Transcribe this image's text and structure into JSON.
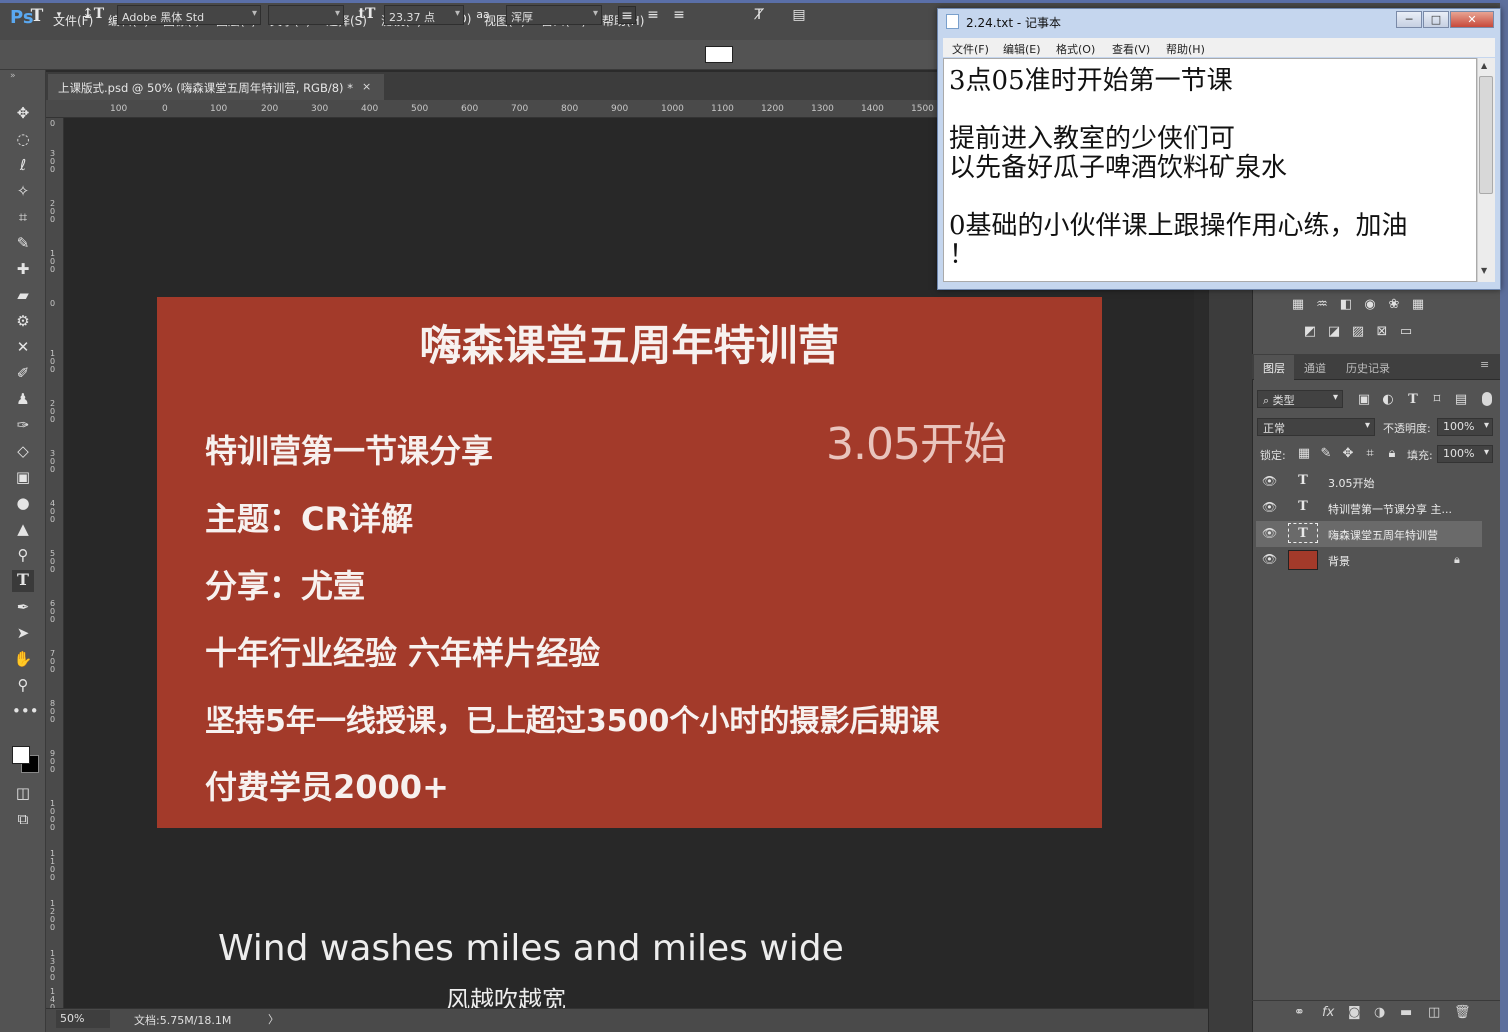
{
  "app": {
    "logo": "Ps",
    "menu": [
      "文件(F)",
      "编辑(E)",
      "图像(I)",
      "图层(L)",
      "文字(Y)",
      "选择(S)",
      "滤镜(T)",
      "3D(D)",
      "视图(V)",
      "窗口(W)",
      "帮助(H)"
    ]
  },
  "options": {
    "font_family": "Adobe 黑体 Std",
    "font_size": "23.37 点",
    "antialias_icon": "aa",
    "antialias": "浑厚"
  },
  "document": {
    "tab_title": "上课版式.psd @ 50% (嗨森课堂五周年特训营, RGB/8) *",
    "close": "×",
    "ruler_h": [
      "100",
      "0",
      "100",
      "200",
      "300",
      "400",
      "500",
      "600",
      "700",
      "800",
      "900",
      "1000",
      "1100",
      "1200",
      "1300",
      "1400",
      "1500"
    ],
    "ruler_v": [
      "0",
      "300",
      "200",
      "100",
      "0",
      "100",
      "200",
      "300",
      "400",
      "500",
      "600",
      "700",
      "800",
      "900",
      "1000",
      "1100",
      "1200",
      "1300",
      "1400"
    ],
    "zoom": "50%",
    "doc_info": "文档:5.75M/18.1M",
    "status_arrow": "〉"
  },
  "artboard": {
    "color": "#a33a2a",
    "title": "嗨森课堂五周年特训营",
    "start": "3.05开始",
    "lines": [
      "特训营第一节课分享",
      "主题：CR详解",
      "分享：尤壹",
      "十年行业经验 六年样片经验",
      "坚持5年一线授课，已上超过3500个小时的摄影后期课",
      "付费学员2000+"
    ]
  },
  "subtitles": {
    "en": "Wind washes miles and miles wide",
    "cn": "风越吹越宽"
  },
  "layers_panel": {
    "tabs": [
      "图层",
      "通道",
      "历史记录"
    ],
    "filter_label": "类型",
    "blend_mode": "正常",
    "opacity_label": "不透明度:",
    "opacity": "100%",
    "lock_label": "锁定:",
    "fill_label": "填充:",
    "fill": "100%",
    "layers": [
      {
        "name": "3.05开始",
        "thumb": "T"
      },
      {
        "name": "特训营第一节课分享 主...",
        "thumb": "T"
      },
      {
        "name": "嗨森课堂五周年特训营",
        "thumb": "T"
      },
      {
        "name": "背景",
        "thumb": ""
      }
    ]
  },
  "notepad": {
    "title": "2.24.txt - 记事本",
    "buttons": {
      "min": "─",
      "max": "□",
      "close": "✕"
    },
    "menu": [
      "文件(F)",
      "编辑(E)",
      "格式(O)",
      "查看(V)",
      "帮助(H)"
    ],
    "lines": [
      "3点05准时开始第一节课",
      "",
      "提前进入教室的少侠们可",
      "以先备好瓜子啤酒饮料矿泉水",
      "",
      "0基础的小伙伴课上跟操作用心练，加油",
      "！"
    ]
  }
}
